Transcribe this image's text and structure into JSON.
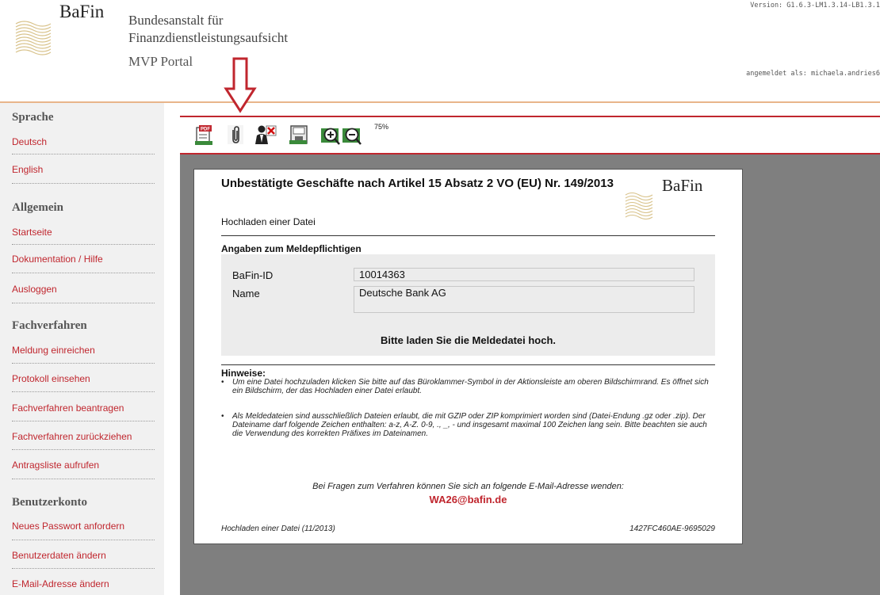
{
  "header": {
    "logo_text": "BaFin",
    "org_line1": "Bundesanstalt für",
    "org_line2": "Finanzdienstleistungsaufsicht",
    "portal": "MVP Portal",
    "version": "Version: G1.6.3-LM1.3.14-LB1.3.1",
    "login_label": "angemeldet als: michaela.andries6"
  },
  "sidebar": {
    "sections": [
      {
        "heading": "Sprache",
        "items": [
          "Deutsch",
          "English"
        ]
      },
      {
        "heading": "Allgemein",
        "items": [
          "Startseite",
          "Dokumentation / Hilfe",
          "Ausloggen"
        ]
      },
      {
        "heading": "Fachverfahren",
        "items": [
          "Meldung einreichen",
          "Protokoll einsehen",
          "Fachverfahren beantragen",
          "Fachverfahren zurückziehen",
          "Antragsliste aufrufen"
        ]
      },
      {
        "heading": "Benutzerkonto",
        "items": [
          "Neues Passwort anfordern",
          "Benutzerdaten ändern",
          "E-Mail-Adresse ändern"
        ]
      }
    ]
  },
  "toolbar": {
    "icons": [
      "pdf-icon",
      "paperclip-icon",
      "user-remove-icon",
      "save-icon",
      "zoom-in-icon",
      "zoom-out-icon"
    ],
    "zoom": "75%"
  },
  "document": {
    "title": "Unbestätigte Geschäfte nach Artikel 15 Absatz 2 VO (EU) Nr. 149/2013",
    "subtitle": "Hochladen einer Datei",
    "logo_text": "BaFin",
    "section_title": "Angaben zum Meldepflichtigen",
    "fields": [
      {
        "label": "BaFin-ID",
        "value": "10014363"
      },
      {
        "label": "Name",
        "value": "Deutsche Bank AG"
      }
    ],
    "upload_message": "Bitte laden Sie die Meldedatei hoch.",
    "hinweise_title": "Hinweise:",
    "notes": [
      "Um eine Datei hochzuladen klicken Sie bitte auf das Büroklammer-Symbol in der Aktionsleiste am oberen Bildschirmrand. Es öffnet sich ein Bildschirm, der das Hochladen einer Datei erlaubt.",
      "Als Meldedateien sind ausschließlich Dateien erlaubt, die mit GZIP oder ZIP komprimiert worden sind (Datei-Endung .gz oder .zip). Der Dateiname darf folgende Zeichen enthalten: a-z, A-Z. 0-9, ., _, - und insgesamt maximal 100 Zeichen lang sein. Bitte beachten sie auch die Verwendung des korrekten Präfixes im Dateinamen."
    ],
    "contact_text": "Bei Fragen zum Verfahren können Sie sich an folgende E-Mail-Adresse wenden:",
    "contact_email": "WA26@bafin.de",
    "footer_left": "Hochladen einer Datei (11/2013)",
    "footer_right": "1427FC460AE-9695029"
  },
  "colors": {
    "accent_red": "#c0262e",
    "header_line": "#e8b58a",
    "sidebar_bg": "#f1f1f1",
    "viewer_bg": "#7f7f7f"
  }
}
